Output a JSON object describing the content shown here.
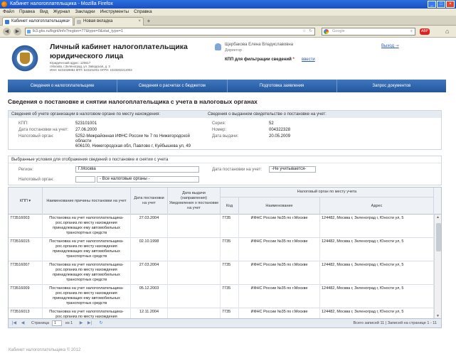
{
  "browser": {
    "window_title": "Кабинет налогоплательщика - Mozilla Firefox",
    "menu": [
      "Файл",
      "Правка",
      "Вид",
      "Журнал",
      "Закладки",
      "Инструменты",
      "Справка"
    ],
    "tabs": [
      {
        "label": "Кабинет налогоплательщика",
        "active": true
      },
      {
        "label": "Новая вкладка",
        "active": false
      }
    ],
    "url": "lk3.gks.ru/lkgnl/info?region=77&type=0&stat_type=1",
    "search_placeholder": "Google"
  },
  "header": {
    "title_line1": "Личный кабинет налогоплательщика",
    "title_line2": "юридического лица",
    "org_lines": [
      "Юридический адрес: 125617",
      "г.Москва, г.Зеленоград, ул. Заводская, д. 3",
      "ИНН: 5231029084    КПП: 523101001    ОГРН: 1023202212003"
    ],
    "user_name": "Щербакова Елена Владиславовна",
    "user_role": "Директор",
    "kpp_filter_label": "КПП для фильтрации сведений",
    "kpp_filter_link": "ввести",
    "exit_link": "Выход"
  },
  "nav": [
    "Сведения о налогоплательщике",
    "Сведения о расчетах с бюджетом",
    "Подготовка заявления",
    "Запрос документов"
  ],
  "section_title": "Сведения о постановке и снятии налогоплательщика с учета в налоговых органах",
  "registration": {
    "left_head": "Сведения об учете организации в налоговом органе по месту нахождения:",
    "right_head": "Сведения о выданном свидетельстве о постановке на учет:",
    "kpp_label": "КПП:",
    "kpp_value": "523101001",
    "date_label": "Дата постановки на учет:",
    "date_value": "27.06.2000",
    "organ_label": "Налоговый орган:",
    "organ_lines": [
      "5252-Межрайонная ИФНС России № 7 по Нижегородской",
      "области",
      "606100, Нижегородская обл, Павлово г, Куйбышева ул, 49"
    ],
    "series_label": "Серия:",
    "series_value": "52",
    "number_label": "Номер:",
    "number_value": "004322328",
    "issue_label": "Дата выдачи:",
    "issue_value": "20.05.2009"
  },
  "filters": {
    "head": "Выбранные условия для отображения сведений о постановке и снятии с учета",
    "region_label": "Регион:",
    "region_value": "Г.Москва",
    "organ_label": "Налоговый орган:",
    "organ_value": "- Все налоговые органы -",
    "date_label": "Дата постановки на учет:",
    "date_value": "-Не учитывается-"
  },
  "table": {
    "headers": {
      "kpp": "КПП ▾",
      "reason": "Наименование причины постановки на учет",
      "date": "Дата постановки на учет",
      "notice": "Дата выдачи (направления) Уведомления о постановке на учет",
      "group": "Налоговый орган по месту учета",
      "code": "Код",
      "name": "Наименование",
      "address": "Адрес"
    },
    "rows": [
      {
        "kpp": "773516003",
        "reason": "Постановка на учет налогоплательщика-рос.организ.по месту нахождения принадлежащих ему автомобильных транспортных средств",
        "date": "27.03.2004",
        "code": "7735",
        "name": "ИФНС России №35 по г.Москве",
        "address": "124482, Москва г, Зеленоград г, Юности ул, 5"
      },
      {
        "kpp": "773516015",
        "reason": "Постановка на учет налогоплательщика-рос.организ.по месту нахождения принадлежащих ему автомобильных транспортных средств",
        "date": "02.10.1998",
        "code": "7735",
        "name": "ИФНС России №35 по г.Москве",
        "address": "124482, Москва г, Зеленоград г, Юности ул, 5"
      },
      {
        "kpp": "773516007",
        "reason": "Постановка на учет налогоплательщика-рос.организ.по месту нахождения принадлежащих ему автомобильных транспортных средств",
        "date": "27.03.2004",
        "code": "7735",
        "name": "ИФНС России №35 по г.Москве",
        "address": "124482, Москва г, Зеленоград г, Юности ул, 5"
      },
      {
        "kpp": "773516009",
        "reason": "Постановка на учет налогоплательщика-рос.организ.по месту нахождения принадлежащих ему автомобильных транспортных средств",
        "date": "05.12.2003",
        "code": "7735",
        "name": "ИФНС России №35 по г.Москве",
        "address": "124482, Москва г, Зеленоград г, Юности ул, 5"
      },
      {
        "kpp": "773516013",
        "reason": "Постановка на учет налогоплательщика-рос.организ.по месту нахождения принадлежащих ему автомобильных транспортных средств",
        "date": "12.11.2004",
        "code": "7735",
        "name": "ИФНС России №35 по г.Москве",
        "address": "124482, Москва г, Зеленоград г, Юности ул, 5"
      }
    ]
  },
  "pager": {
    "page_label": "Страница",
    "page_value": "1",
    "of_label": "из 1",
    "summary": "Всего записей 11 | Записей на странице 1 - 11"
  },
  "footer": "Кабинет налогоплательщика © 2012"
}
